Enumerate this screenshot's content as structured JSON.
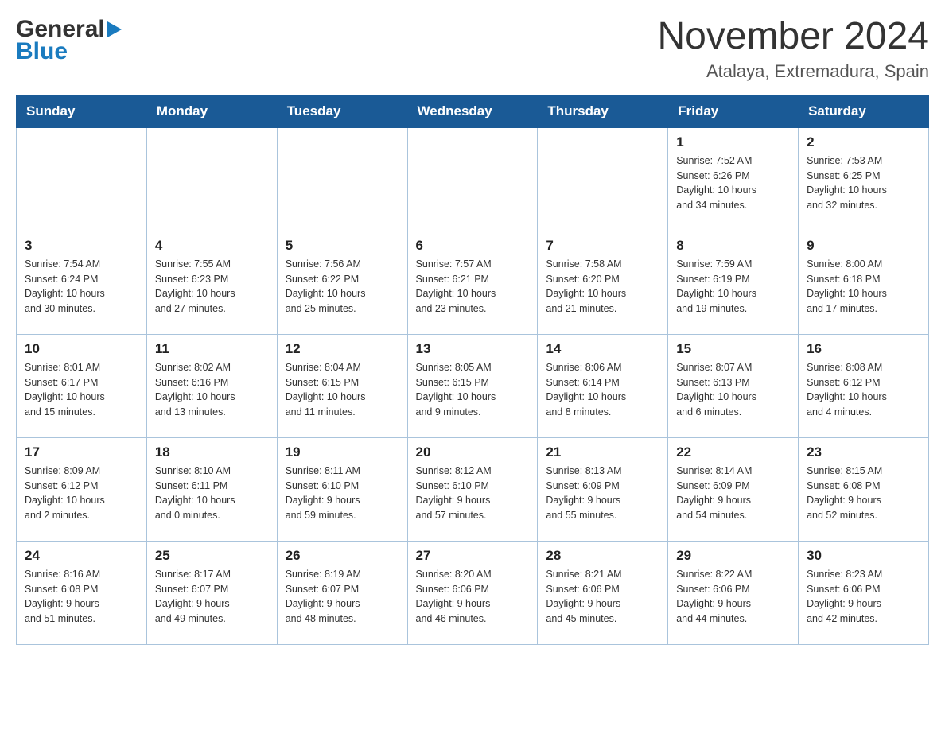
{
  "header": {
    "month_title": "November 2024",
    "location": "Atalaya, Extremadura, Spain",
    "logo_general": "General",
    "logo_blue": "Blue"
  },
  "days_of_week": [
    "Sunday",
    "Monday",
    "Tuesday",
    "Wednesday",
    "Thursday",
    "Friday",
    "Saturday"
  ],
  "weeks": [
    [
      {
        "day": "",
        "info": ""
      },
      {
        "day": "",
        "info": ""
      },
      {
        "day": "",
        "info": ""
      },
      {
        "day": "",
        "info": ""
      },
      {
        "day": "",
        "info": ""
      },
      {
        "day": "1",
        "info": "Sunrise: 7:52 AM\nSunset: 6:26 PM\nDaylight: 10 hours\nand 34 minutes."
      },
      {
        "day": "2",
        "info": "Sunrise: 7:53 AM\nSunset: 6:25 PM\nDaylight: 10 hours\nand 32 minutes."
      }
    ],
    [
      {
        "day": "3",
        "info": "Sunrise: 7:54 AM\nSunset: 6:24 PM\nDaylight: 10 hours\nand 30 minutes."
      },
      {
        "day": "4",
        "info": "Sunrise: 7:55 AM\nSunset: 6:23 PM\nDaylight: 10 hours\nand 27 minutes."
      },
      {
        "day": "5",
        "info": "Sunrise: 7:56 AM\nSunset: 6:22 PM\nDaylight: 10 hours\nand 25 minutes."
      },
      {
        "day": "6",
        "info": "Sunrise: 7:57 AM\nSunset: 6:21 PM\nDaylight: 10 hours\nand 23 minutes."
      },
      {
        "day": "7",
        "info": "Sunrise: 7:58 AM\nSunset: 6:20 PM\nDaylight: 10 hours\nand 21 minutes."
      },
      {
        "day": "8",
        "info": "Sunrise: 7:59 AM\nSunset: 6:19 PM\nDaylight: 10 hours\nand 19 minutes."
      },
      {
        "day": "9",
        "info": "Sunrise: 8:00 AM\nSunset: 6:18 PM\nDaylight: 10 hours\nand 17 minutes."
      }
    ],
    [
      {
        "day": "10",
        "info": "Sunrise: 8:01 AM\nSunset: 6:17 PM\nDaylight: 10 hours\nand 15 minutes."
      },
      {
        "day": "11",
        "info": "Sunrise: 8:02 AM\nSunset: 6:16 PM\nDaylight: 10 hours\nand 13 minutes."
      },
      {
        "day": "12",
        "info": "Sunrise: 8:04 AM\nSunset: 6:15 PM\nDaylight: 10 hours\nand 11 minutes."
      },
      {
        "day": "13",
        "info": "Sunrise: 8:05 AM\nSunset: 6:15 PM\nDaylight: 10 hours\nand 9 minutes."
      },
      {
        "day": "14",
        "info": "Sunrise: 8:06 AM\nSunset: 6:14 PM\nDaylight: 10 hours\nand 8 minutes."
      },
      {
        "day": "15",
        "info": "Sunrise: 8:07 AM\nSunset: 6:13 PM\nDaylight: 10 hours\nand 6 minutes."
      },
      {
        "day": "16",
        "info": "Sunrise: 8:08 AM\nSunset: 6:12 PM\nDaylight: 10 hours\nand 4 minutes."
      }
    ],
    [
      {
        "day": "17",
        "info": "Sunrise: 8:09 AM\nSunset: 6:12 PM\nDaylight: 10 hours\nand 2 minutes."
      },
      {
        "day": "18",
        "info": "Sunrise: 8:10 AM\nSunset: 6:11 PM\nDaylight: 10 hours\nand 0 minutes."
      },
      {
        "day": "19",
        "info": "Sunrise: 8:11 AM\nSunset: 6:10 PM\nDaylight: 9 hours\nand 59 minutes."
      },
      {
        "day": "20",
        "info": "Sunrise: 8:12 AM\nSunset: 6:10 PM\nDaylight: 9 hours\nand 57 minutes."
      },
      {
        "day": "21",
        "info": "Sunrise: 8:13 AM\nSunset: 6:09 PM\nDaylight: 9 hours\nand 55 minutes."
      },
      {
        "day": "22",
        "info": "Sunrise: 8:14 AM\nSunset: 6:09 PM\nDaylight: 9 hours\nand 54 minutes."
      },
      {
        "day": "23",
        "info": "Sunrise: 8:15 AM\nSunset: 6:08 PM\nDaylight: 9 hours\nand 52 minutes."
      }
    ],
    [
      {
        "day": "24",
        "info": "Sunrise: 8:16 AM\nSunset: 6:08 PM\nDaylight: 9 hours\nand 51 minutes."
      },
      {
        "day": "25",
        "info": "Sunrise: 8:17 AM\nSunset: 6:07 PM\nDaylight: 9 hours\nand 49 minutes."
      },
      {
        "day": "26",
        "info": "Sunrise: 8:19 AM\nSunset: 6:07 PM\nDaylight: 9 hours\nand 48 minutes."
      },
      {
        "day": "27",
        "info": "Sunrise: 8:20 AM\nSunset: 6:06 PM\nDaylight: 9 hours\nand 46 minutes."
      },
      {
        "day": "28",
        "info": "Sunrise: 8:21 AM\nSunset: 6:06 PM\nDaylight: 9 hours\nand 45 minutes."
      },
      {
        "day": "29",
        "info": "Sunrise: 8:22 AM\nSunset: 6:06 PM\nDaylight: 9 hours\nand 44 minutes."
      },
      {
        "day": "30",
        "info": "Sunrise: 8:23 AM\nSunset: 6:06 PM\nDaylight: 9 hours\nand 42 minutes."
      }
    ]
  ]
}
